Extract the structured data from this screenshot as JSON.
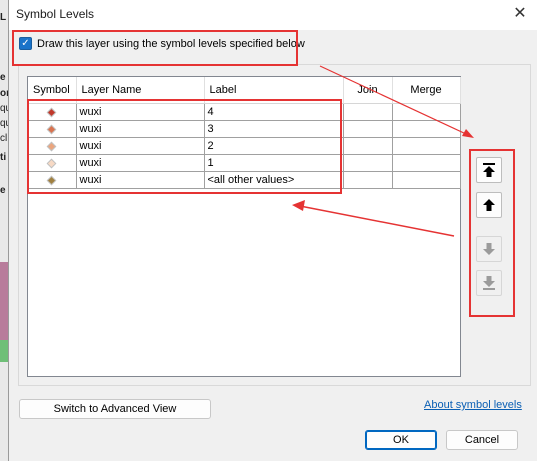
{
  "dialog": {
    "title": "Symbol Levels",
    "close_glyph": "✕"
  },
  "background_app": {
    "fragments": [
      "L",
      "e",
      "or",
      "qu",
      "qu",
      "cl",
      "ti",
      "e"
    ]
  },
  "options": {
    "use_symbol_levels_label": "Draw this layer using the symbol levels specified below",
    "use_symbol_levels_checked": true
  },
  "grid": {
    "columns": [
      "Symbol",
      "Layer Name",
      "Label",
      "Join",
      "Merge"
    ],
    "rows": [
      {
        "symbol_color": "#c0392b",
        "layer": "wuxi",
        "label": "4",
        "join": "",
        "merge": ""
      },
      {
        "symbol_color": "#d9734f",
        "layer": "wuxi",
        "label": "3",
        "join": "",
        "merge": ""
      },
      {
        "symbol_color": "#eaa57e",
        "layer": "wuxi",
        "label": "2",
        "join": "",
        "merge": ""
      },
      {
        "symbol_color": "#f7d9c4",
        "layer": "wuxi",
        "label": "1",
        "join": "",
        "merge": ""
      },
      {
        "symbol_color": "#a08040",
        "layer": "wuxi",
        "label": "<all other values>",
        "join": "",
        "merge": ""
      }
    ]
  },
  "order_buttons": [
    {
      "name": "move-to-top-button",
      "icon": "arrow-to-top-icon",
      "enabled": true
    },
    {
      "name": "move-up-button",
      "icon": "arrow-up-icon",
      "enabled": true
    },
    {
      "name": "move-down-button",
      "icon": "arrow-down-icon",
      "enabled": false
    },
    {
      "name": "move-to-bottom-button",
      "icon": "arrow-to-bottom-icon",
      "enabled": false
    }
  ],
  "footer": {
    "advanced_view_label": "Switch to Advanced View",
    "about_link": "About symbol levels",
    "ok_label": "OK",
    "cancel_label": "Cancel"
  },
  "colors": {
    "annotation_red": "#e53333",
    "accent_blue": "#1a73c9"
  }
}
